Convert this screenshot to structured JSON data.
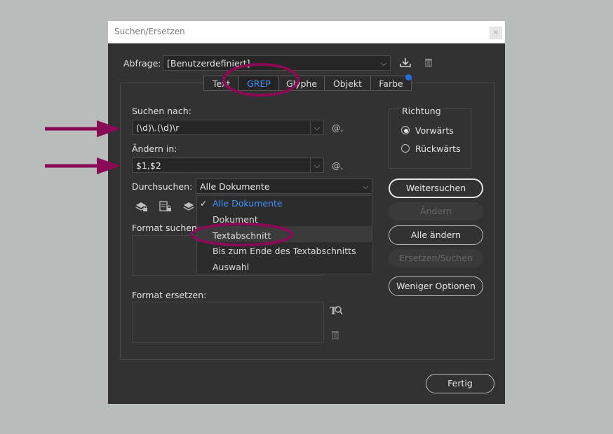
{
  "window": {
    "title": "Suchen/Ersetzen",
    "close_label": "×"
  },
  "query": {
    "label": "Abfrage:",
    "value": "[Benutzerdefiniert]"
  },
  "tabs": [
    {
      "label": "Text"
    },
    {
      "label": "GREP",
      "active": true
    },
    {
      "label": "Glyphe"
    },
    {
      "label": "Objekt"
    },
    {
      "label": "Farbe"
    }
  ],
  "search": {
    "label": "Suchen nach:",
    "value": "(\\d)\\.(\\d)\\r"
  },
  "replace": {
    "label": "Ändern in:",
    "value": "$1,$2"
  },
  "special_char": "@,",
  "scope": {
    "label": "Durchsuchen:",
    "value": "Alle Dokumente"
  },
  "menu": {
    "items": [
      {
        "label": "Alle Dokumente",
        "checked": true
      },
      {
        "label": "Dokument"
      },
      {
        "label": "Textabschnitt",
        "highlighted": true
      },
      {
        "label": "Bis zum Ende des Textabschnitts"
      },
      {
        "label": "Auswahl"
      }
    ]
  },
  "format_search": {
    "label": "Format suchen:"
  },
  "format_replace": {
    "label": "Format ersetzen:"
  },
  "direction": {
    "title": "Richtung",
    "forward": "Vorwärts",
    "backward": "Rückwärts"
  },
  "buttons": {
    "find_next": "Weitersuchen",
    "change": "Ändern",
    "change_all": "Alle ändern",
    "change_find": "Ersetzen/Suchen",
    "fewer_options": "Weniger Optionen",
    "done": "Fertig"
  },
  "colors": {
    "annotation": "#8b0a55",
    "accent": "#3d95ff",
    "badge": "#1f6fe0"
  }
}
